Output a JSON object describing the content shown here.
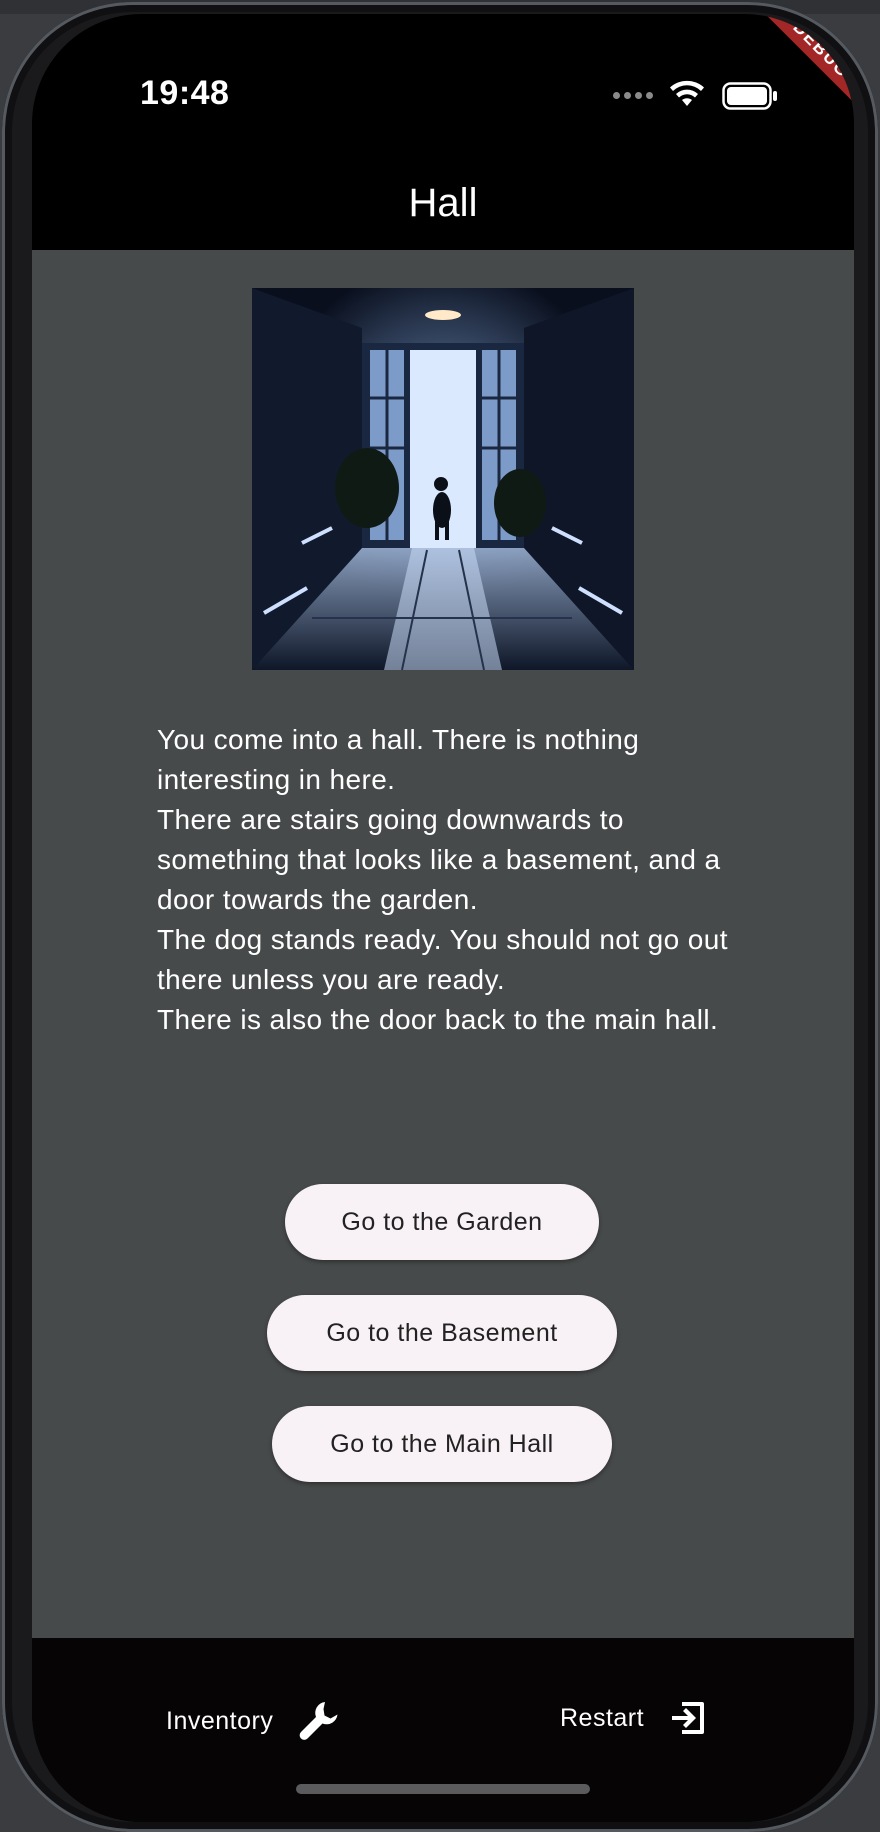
{
  "status_bar": {
    "time": "19:48"
  },
  "debug_banner": {
    "label": "DEBUG",
    "color": "#a32727"
  },
  "app_bar": {
    "title": "Hall"
  },
  "room": {
    "description": [
      "You come into a hall. There is nothing interesting in here.",
      "There are stairs going downwards to something that looks like a basement, and a door towards the garden.",
      "The dog stands ready. You should not go out there unless you are ready.",
      "There is also the door back to the main hall."
    ],
    "image_icon": "hallway-with-dog-image"
  },
  "actions": {
    "garden": "Go to the Garden",
    "basement": "Go to the Basement",
    "main_hall": "Go to the Main Hall"
  },
  "bottom_bar": {
    "inventory": {
      "label": "Inventory",
      "icon": "wrench-icon"
    },
    "restart": {
      "label": "Restart",
      "icon": "exit-icon"
    }
  },
  "colors": {
    "content_background": "#474a4a",
    "button_background": "#f8f1f5",
    "bottom_bar": "#060405"
  }
}
